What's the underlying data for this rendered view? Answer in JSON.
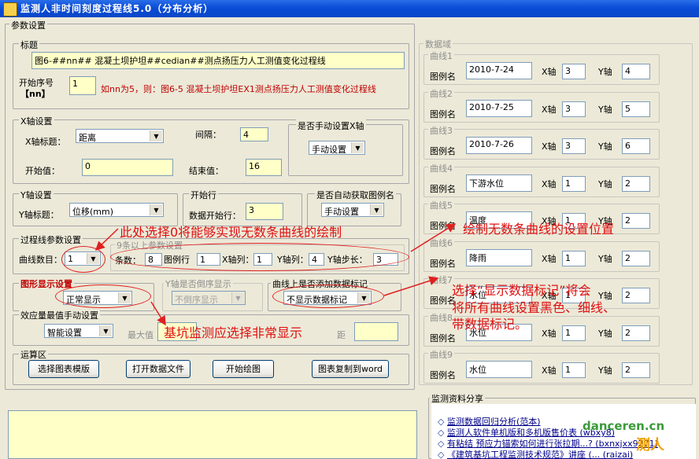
{
  "window": {
    "title": "监测人非时间刻度过程线5.0（分布分析）"
  },
  "params": {
    "group_label": "参数设置",
    "title_group": "标题",
    "title_value": "图6-##nn##   混凝土坝护坦##cedian##测点扬压力人工测值变化过程线",
    "start_no_label_1": "开始序号",
    "start_no_label_2": "【nn】",
    "start_no_value": "1",
    "start_no_hint": "如nn为5，则：图6-5    混凝土坝护坦EX1测点扬压力人工测值变化过程线"
  },
  "xaxis": {
    "group_label": "X轴设置",
    "title_label": "X轴标题：",
    "title_value": "距离",
    "interval_label": "间隔：",
    "interval_value": "4",
    "start_label": "开始值：",
    "start_value": "0",
    "end_label": "结束值：",
    "end_value": "16",
    "manual_group": "是否手动设置X轴",
    "manual_value": "手动设置"
  },
  "yaxis": {
    "group_label": "Y轴设置",
    "title_label": "Y轴标题：",
    "title_value": "位移(mm)"
  },
  "start_row": {
    "group_label": "开始行",
    "label": "数据开始行：",
    "value": "3"
  },
  "auto_legend": {
    "group_label": "是否自动获取图例名",
    "value": "手动设置"
  },
  "curve_params": {
    "group_label": "过程线参数设置",
    "count_label": "曲线数目：",
    "count_value": "1",
    "sub_group": "9条以上参数设置",
    "tiao_label": "条数：",
    "tiao_value": "8",
    "legend_row_label": "图例行",
    "legend_row_value": "1",
    "xcol_label": "X轴列：",
    "xcol_value": "1",
    "ycol_label": "Y轴列：",
    "ycol_value": "4",
    "ystep_label": "Y轴步长：",
    "ystep_value": "3"
  },
  "display": {
    "group_label": "图形显示设置",
    "value": "正常显示",
    "reverse_group": "Y轴是否倒序显示",
    "reverse_value": "不倒序显示",
    "marker_group": "曲线上是否添加数据标记",
    "marker_value": "不显示数据标记"
  },
  "effect": {
    "group_label": "效应量最值手动设置",
    "value": "智能设置",
    "max_label": "最大值",
    "min_label": "距"
  },
  "ops": {
    "group_label": "运算区",
    "btn_template": "选择图表模版",
    "btn_open": "打开数据文件",
    "btn_draw": "开始绘图",
    "btn_copy": "图表复制到word"
  },
  "data_domain": {
    "label": "数据域",
    "name_label": "图例名",
    "x_label": "X轴",
    "y_label": "Y轴",
    "curves": [
      {
        "label": "曲线1",
        "name": "2010-7-24",
        "x": "3",
        "y": "4"
      },
      {
        "label": "曲线2",
        "name": "2010-7-25",
        "x": "3",
        "y": "5"
      },
      {
        "label": "曲线3",
        "name": "2010-7-26",
        "x": "3",
        "y": "6"
      },
      {
        "label": "曲线4",
        "name": "下游水位",
        "x": "1",
        "y": "2"
      },
      {
        "label": "曲线5",
        "name": "温度",
        "x": "1",
        "y": "2"
      },
      {
        "label": "曲线6",
        "name": "降雨",
        "x": "1",
        "y": "2"
      },
      {
        "label": "曲线7",
        "name": "水位",
        "x": "1",
        "y": "2"
      },
      {
        "label": "曲线8",
        "name": "水位",
        "x": "1",
        "y": "2"
      },
      {
        "label": "曲线9",
        "name": "水位",
        "x": "1",
        "y": "2"
      }
    ]
  },
  "share": {
    "group_label": "监测资料分享",
    "items": [
      "监测数据回归分析(范本)",
      "监测人软件单机版和多机版售价表 (wbxy8)",
      "有粘结 预应力锚索如何进行张拉期...? (bxnxjxx9271)",
      "《建筑基坑工程监测技术规范》讲座 (... (raizai)"
    ],
    "watermark": "danceren.cn",
    "watermark_cn": "测人"
  },
  "annotations": {
    "a1": "此处选择0将能够实现无数条曲线的绘制",
    "a2": "绘制无数条曲线的设置位置",
    "a3_1": "选择“显示数据标记”将会",
    "a3_2": "将所有曲线设置黑色、细线、",
    "a3_3": "带数据标记。",
    "a4": "基坑监测应选择非常显示"
  },
  "colors": {
    "title_bar": "#0a4cd6",
    "window_bg": "#ece9d8",
    "annotation": "#e01010",
    "yellow_field": "#ffffc8"
  }
}
